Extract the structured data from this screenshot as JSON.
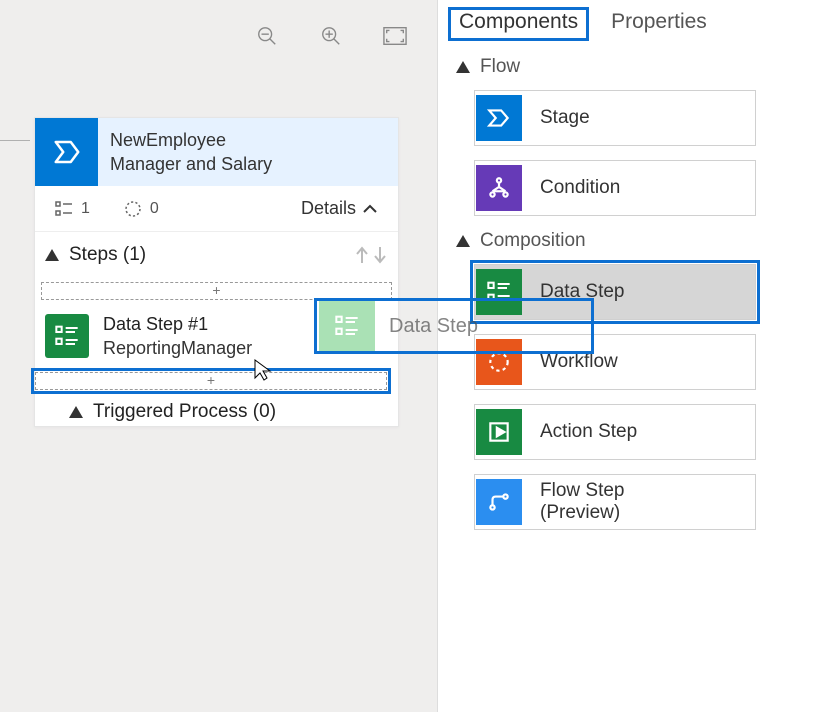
{
  "toolbar": {
    "zoom_out": "zoom-out",
    "zoom_in": "zoom-in",
    "fit": "fit-screen"
  },
  "stage": {
    "title_line1": "NewEmployee",
    "title_line2": "Manager and Salary",
    "stat_list_count": "1",
    "stat_cycle_count": "0",
    "details_label": "Details",
    "steps_header": "Steps (1)",
    "drop_plus": "+",
    "step": {
      "title": "Data Step #1",
      "subtitle": "ReportingManager"
    },
    "drop_plus2": "+",
    "triggered": "Triggered Process (0)"
  },
  "drag": {
    "label": "Data Step"
  },
  "panel": {
    "tabs": {
      "components": "Components",
      "properties": "Properties"
    },
    "sections": {
      "flow": "Flow",
      "composition": "Composition"
    },
    "items": {
      "stage": "Stage",
      "condition": "Condition",
      "data_step": "Data Step",
      "workflow": "Workflow",
      "action_step": "Action Step",
      "flow_step_l1": "Flow Step",
      "flow_step_l2": "(Preview)"
    }
  }
}
